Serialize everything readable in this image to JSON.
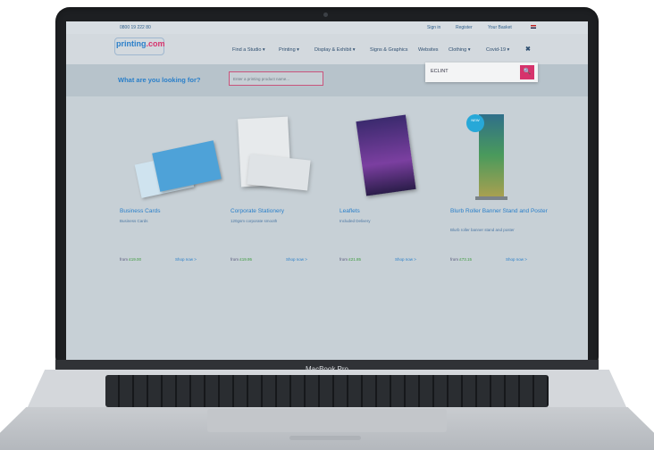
{
  "device": {
    "label": "MacBook Pro"
  },
  "topbar": {
    "phone": "0800 19 222 80",
    "signin": "Sign in",
    "register": "Register",
    "basket": "Your Basket"
  },
  "logo": {
    "text": "printing",
    "suffix": ".com"
  },
  "nav": {
    "items": [
      {
        "label": "Find a Studio ▾"
      },
      {
        "label": "Printing ▾"
      },
      {
        "label": "Display & Exhibit ▾"
      },
      {
        "label": "Signs & Graphics"
      },
      {
        "label": "Websites"
      },
      {
        "label": "Clothing ▾"
      },
      {
        "label": "Covid-19 ▾"
      }
    ],
    "close": "✖"
  },
  "search_dropdown": {
    "value": "ECLINT",
    "button_icon": "🔍"
  },
  "search_band": {
    "question": "What are you looking for?",
    "placeholder": "Enter a printing product name..."
  },
  "products": [
    {
      "title": "Business Cards",
      "subtitle": "Business Cards",
      "from": "from",
      "price": "£19.00",
      "shop": "Shop now >"
    },
    {
      "title": "Corporate Stationery",
      "subtitle": "120gsm corporate smooth",
      "from": "from",
      "price": "£19.95",
      "shop": "Shop now >"
    },
    {
      "title": "Leaflets",
      "subtitle": "Included Delivery",
      "from": "from",
      "price": "£21.85",
      "shop": "Shop now >"
    },
    {
      "title": "Blurb Roller Banner Stand and Poster",
      "subtitle": "Blurb roller banner stand and poster",
      "from": "from",
      "price": "£73.15",
      "shop": "Shop now >",
      "badge": "NEW"
    }
  ],
  "colors": {
    "accent": "#2a7fc9",
    "pink": "#d6336c",
    "price_green": "#3c9a3c"
  }
}
